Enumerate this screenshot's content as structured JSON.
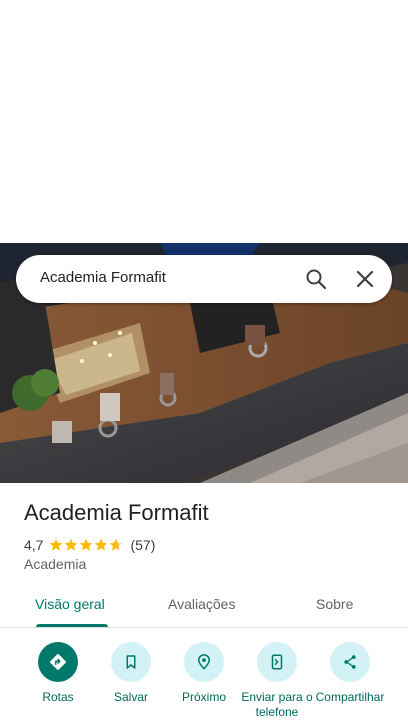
{
  "search": {
    "query": "Academia Formafit"
  },
  "place": {
    "name": "Academia Formafit",
    "rating": "4,7",
    "rating_fraction": 0.94,
    "review_count": "(57)",
    "category": "Academia"
  },
  "tabs": [
    {
      "label": "Visão geral",
      "active": true
    },
    {
      "label": "Avaliações",
      "active": false
    },
    {
      "label": "Sobre",
      "active": false
    }
  ],
  "actions": [
    {
      "label": "Rotas",
      "icon": "directions-icon"
    },
    {
      "label": "Salvar",
      "icon": "bookmark-icon"
    },
    {
      "label": "Próximo",
      "icon": "nearby-icon"
    },
    {
      "label": "Enviar para o telefone",
      "icon": "send-to-phone-icon"
    },
    {
      "label": "Compartilhar",
      "icon": "share-icon"
    }
  ],
  "colors": {
    "accent": "#00796b",
    "action_bg": "#d3f2f5",
    "star": "#fbbc04"
  }
}
